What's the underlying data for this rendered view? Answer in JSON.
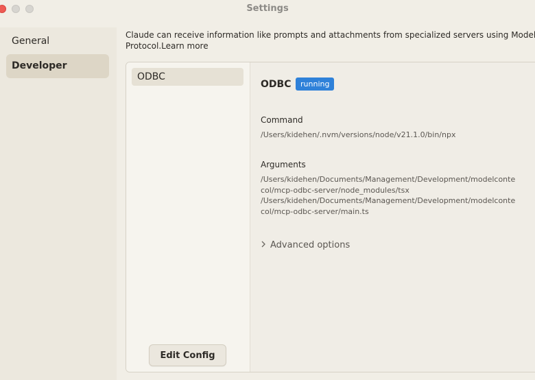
{
  "window": {
    "title": "Settings"
  },
  "sidebar": {
    "items": [
      {
        "label": "General",
        "active": false
      },
      {
        "label": "Developer",
        "active": true
      }
    ]
  },
  "intro": {
    "text": "Claude can receive information like prompts and attachments from specialized servers using Model Context Protocol.",
    "line1": "Claude can receive information like prompts and attachments from specialized servers using Model C",
    "line2": "Protocol.",
    "learn_more": "Learn more"
  },
  "servers": {
    "items": [
      {
        "name": "ODBC"
      }
    ],
    "edit_config_label": "Edit Config"
  },
  "detail": {
    "name": "ODBC",
    "status": "running",
    "status_color": "#2f81d9",
    "command_label": "Command",
    "command": "/Users/kidehen/.nvm/versions/node/v21.1.0/bin/npx",
    "arguments_label": "Arguments",
    "arguments": "/Users/kidehen/Documents/Management/Development/modelcontextprotocol/mcp-odbc-server/node_modules/tsx\n/Users/kidehen/Documents/Management/Development/modelcontextprotocol/mcp-odbc-server/main.ts",
    "arguments_display": "/Users/kidehen/Documents/Management/Development/modelconte\ncol/mcp-odbc-server/node_modules/tsx\n/Users/kidehen/Documents/Management/Development/modelconte\ncol/mcp-odbc-server/main.ts",
    "advanced_label": "Advanced options",
    "advanced_icon": "chevron-right-icon"
  }
}
